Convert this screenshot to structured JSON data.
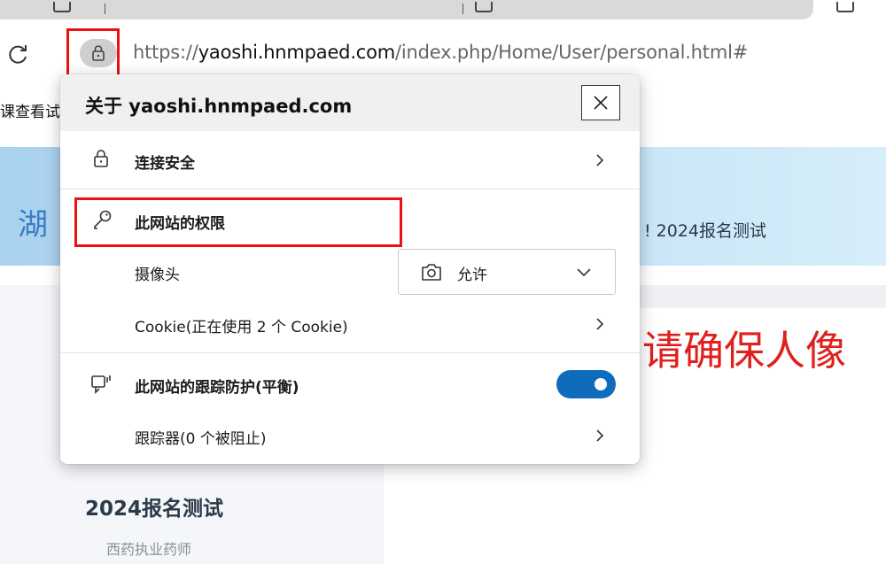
{
  "browser": {
    "url_prefix": "https://",
    "url_host": "yaoshi.hnmpaed.com",
    "url_path": "/index.php/Home/User/personal.html#"
  },
  "page": {
    "bookmark_fragment": "课查看试",
    "banner_char": "湖",
    "banner_text": "! 2024报名测试",
    "headline": "请确保人像",
    "exam_title": "2024报名测试",
    "exam_subtitle": "西药执业药师"
  },
  "popup": {
    "title": "关于 yaoshi.hnmpaed.com",
    "connection_label": "连接安全",
    "permissions_label": "此网站的权限",
    "camera_label": "摄像头",
    "camera_value": "允许",
    "cookie_label": "Cookie(正在使用 2 个 Cookie)",
    "tracking_label": "此网站的跟踪防护(平衡)",
    "tracking_enabled": true,
    "trackers_label": "跟踪器(0 个被阻止)"
  },
  "colors": {
    "annotation_red": "#ee1111",
    "toggle_blue": "#0f6cbd",
    "headline_red": "#e0201c"
  }
}
